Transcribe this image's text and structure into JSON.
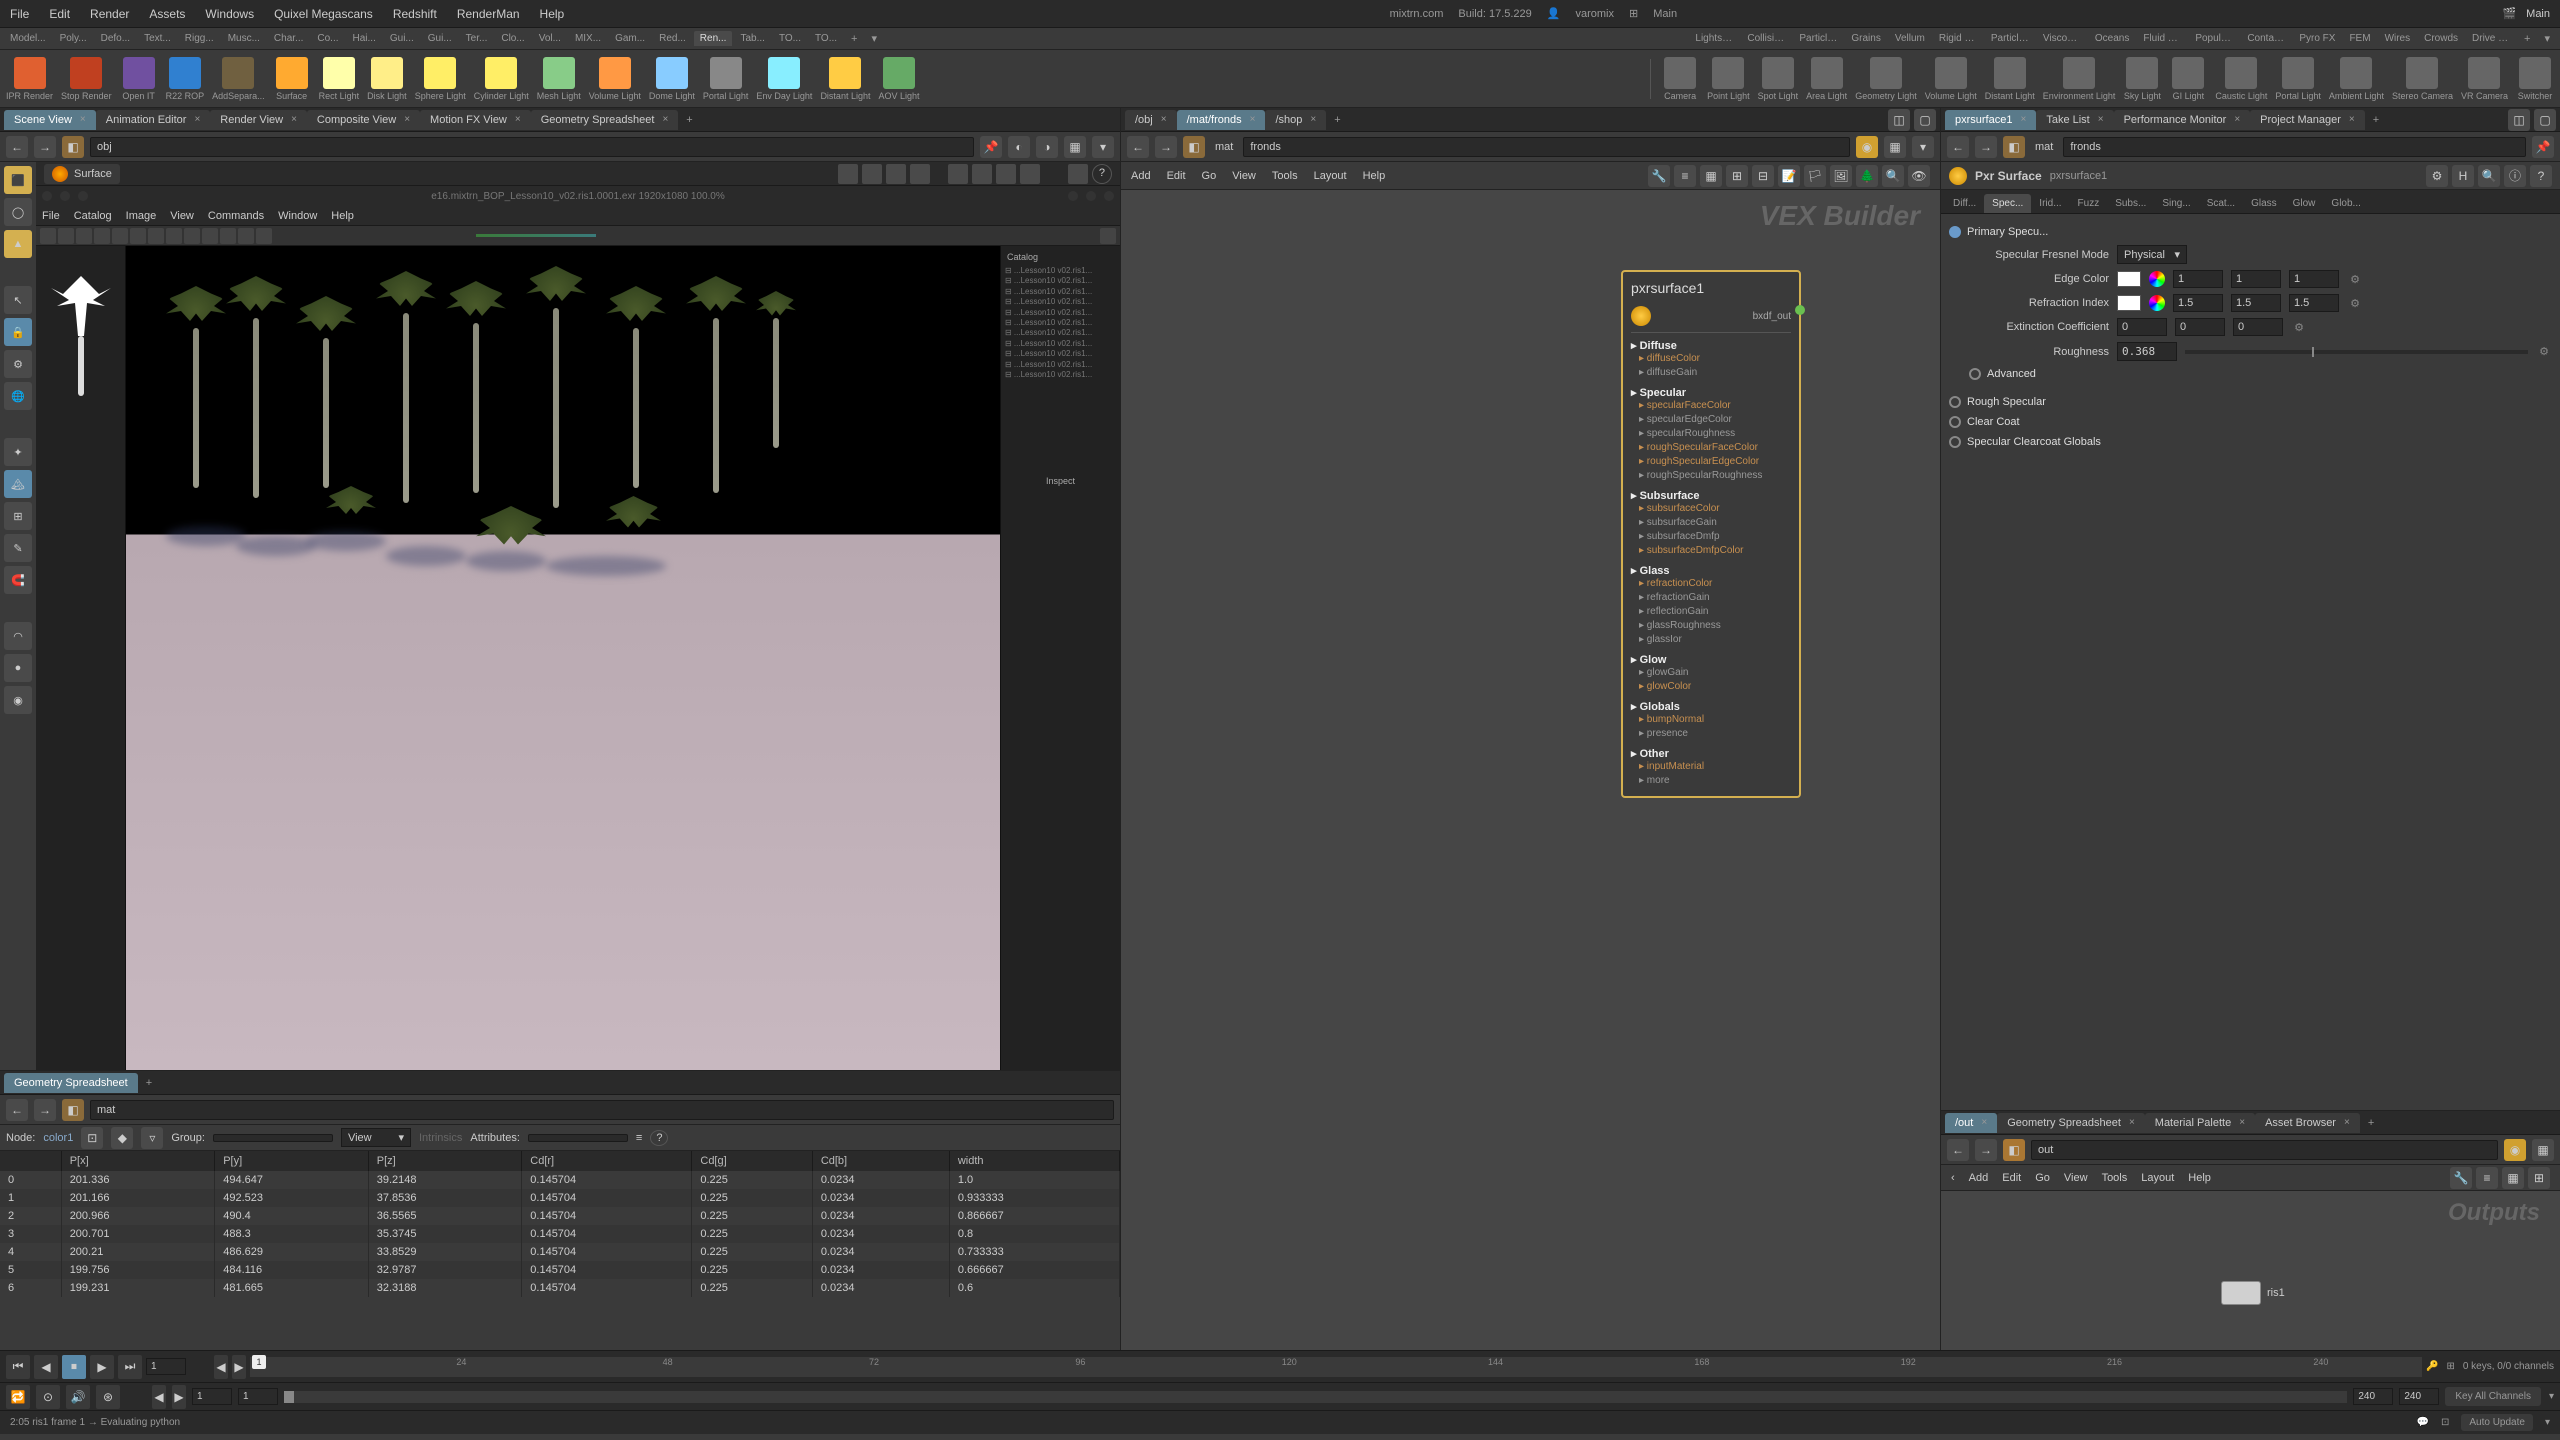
{
  "menubar": {
    "items": [
      "File",
      "Edit",
      "Render",
      "Assets",
      "Windows",
      "Quixel Megascans",
      "Redshift",
      "RenderMan",
      "Help"
    ],
    "center_url": "mixtrn.com",
    "center_build": "Build: 17.5.229",
    "center_user": "varomix",
    "center_desktop": "Main",
    "right_desktop": "Main"
  },
  "shelf_tabs_left": [
    "Model...",
    "Poly...",
    "Defo...",
    "Text...",
    "Rigg...",
    "Musc...",
    "Char...",
    "Co...",
    "Hai...",
    "Gui...",
    "Gui...",
    "Ter...",
    "Clo...",
    "Vol...",
    "MIX...",
    "Gam...",
    "Red...",
    "Ren...",
    "Tab...",
    "TO...",
    "TO..."
  ],
  "shelf_tabs_right": [
    "Lights an...",
    "Collisions",
    "Particles",
    "Grains",
    "Vellum",
    "Rigid Bo...",
    "Particle F...",
    "Viscous F...",
    "Oceans",
    "Fluid Co...",
    "Populate...",
    "Container...",
    "Pyro FX",
    "FEM",
    "Wires",
    "Crowds",
    "Drive Si..."
  ],
  "shelf_tools_left": [
    {
      "label": "IPR Render",
      "color": "#e06030"
    },
    {
      "label": "Stop Render",
      "color": "#c04020"
    },
    {
      "label": "Open IT",
      "color": "#7050a0"
    },
    {
      "label": "R22 ROP",
      "color": "#3080d0"
    },
    {
      "label": "AddSepara...",
      "color": "#706040"
    },
    {
      "label": "Surface",
      "color": "#ffaa30"
    },
    {
      "label": "Rect Light",
      "color": "#ffffaa"
    },
    {
      "label": "Disk Light",
      "color": "#ffee88"
    },
    {
      "label": "Sphere Light",
      "color": "#ffee66"
    },
    {
      "label": "Cylinder Light",
      "color": "#ffee66"
    },
    {
      "label": "Mesh Light",
      "color": "#88cc88"
    },
    {
      "label": "Volume Light",
      "color": "#ff9944"
    },
    {
      "label": "Dome Light",
      "color": "#88ccff"
    },
    {
      "label": "Portal Light",
      "color": "#888888"
    },
    {
      "label": "Env Day Light",
      "color": "#88eeff"
    },
    {
      "label": "Distant Light",
      "color": "#ffcc44"
    },
    {
      "label": "AOV Light",
      "color": "#66aa66"
    }
  ],
  "shelf_tools_right": [
    {
      "label": "Camera"
    },
    {
      "label": "Point Light"
    },
    {
      "label": "Spot Light"
    },
    {
      "label": "Area Light"
    },
    {
      "label": "Geometry Light"
    },
    {
      "label": "Volume Light"
    },
    {
      "label": "Distant Light"
    },
    {
      "label": "Environment Light"
    },
    {
      "label": "Sky Light"
    },
    {
      "label": "GI Light"
    },
    {
      "label": "Caustic Light"
    },
    {
      "label": "Portal Light"
    },
    {
      "label": "Ambient Light"
    },
    {
      "label": "Stereo Camera"
    },
    {
      "label": "VR Camera"
    },
    {
      "label": "Switcher"
    }
  ],
  "left_pane": {
    "tabs": [
      {
        "label": "Scene View",
        "active": true
      },
      {
        "label": "Animation Editor"
      },
      {
        "label": "Render View"
      },
      {
        "label": "Composite View"
      },
      {
        "label": "Motion FX View"
      },
      {
        "label": "Geometry Spreadsheet"
      }
    ],
    "path": "obj",
    "surface_label": "Surface",
    "help_icon": "?",
    "render_preview": {
      "menus": [
        "File",
        "Catalog",
        "Image",
        "View",
        "Commands",
        "Window",
        "Help"
      ],
      "title": "e16.mixtrn_BOP_Lesson10_v02.ris1.0001.exr 1920x1080 100.0%"
    }
  },
  "middle_pane": {
    "tabs": [
      {
        "label": "/obj"
      },
      {
        "label": "/mat/fronds",
        "active": true
      },
      {
        "label": "/shop"
      }
    ],
    "path_root": "mat",
    "path": "fronds",
    "menus": [
      "Add",
      "Edit",
      "Go",
      "View",
      "Tools",
      "Layout",
      "Help"
    ],
    "vex_title": "VEX Builder",
    "node": {
      "name": "pxrsurface1",
      "output": "bxdf_out",
      "sections": [
        {
          "title": "Diffuse",
          "params": [
            {
              "n": "diffuseColor",
              "u": true
            },
            {
              "n": "diffuseGain",
              "u": false
            }
          ]
        },
        {
          "title": "Specular",
          "params": [
            {
              "n": "specularFaceColor",
              "u": true
            },
            {
              "n": "specularEdgeColor",
              "u": false
            },
            {
              "n": "specularRoughness",
              "u": false
            },
            {
              "n": "roughSpecularFaceColor",
              "u": true
            },
            {
              "n": "roughSpecularEdgeColor",
              "u": true
            },
            {
              "n": "roughSpecularRoughness",
              "u": false
            }
          ]
        },
        {
          "title": "Subsurface",
          "params": [
            {
              "n": "subsurfaceColor",
              "u": true
            },
            {
              "n": "subsurfaceGain",
              "u": false
            },
            {
              "n": "subsurfaceDmfp",
              "u": false
            },
            {
              "n": "subsurfaceDmfpColor",
              "u": true
            }
          ]
        },
        {
          "title": "Glass",
          "params": [
            {
              "n": "refractionColor",
              "u": true
            },
            {
              "n": "refractionGain",
              "u": false
            },
            {
              "n": "reflectionGain",
              "u": false
            },
            {
              "n": "glassRoughness",
              "u": false
            },
            {
              "n": "glassIor",
              "u": false
            }
          ]
        },
        {
          "title": "Glow",
          "params": [
            {
              "n": "glowGain",
              "u": false
            },
            {
              "n": "glowColor",
              "u": true
            }
          ]
        },
        {
          "title": "Globals",
          "params": [
            {
              "n": "bumpNormal",
              "u": true
            },
            {
              "n": "presence",
              "u": false
            }
          ]
        },
        {
          "title": "Other",
          "params": [
            {
              "n": "inputMaterial",
              "u": true
            },
            {
              "n": "more",
              "u": false
            }
          ]
        }
      ]
    }
  },
  "right_pane": {
    "tabs": [
      {
        "label": "pxrsurface1",
        "active": true
      },
      {
        "label": "Take List"
      },
      {
        "label": "Performance Monitor"
      },
      {
        "label": "Project Manager"
      }
    ],
    "path_root": "mat",
    "path": "fronds",
    "node_type": "Pxr Surface",
    "node_name": "pxrsurface1",
    "param_tabs": [
      "Diff...",
      "Spec...",
      "Irid...",
      "Fuzz",
      "Subs...",
      "Sing...",
      "Scat...",
      "Glass",
      "Glow",
      "Glob..."
    ],
    "param_tab_active": 1,
    "groups": {
      "primary": "Primary Specu...",
      "rough": "Rough Specular",
      "clearcoat": "Clear Coat",
      "clearcoat_globals": "Specular Clearcoat Globals",
      "advanced": "Advanced"
    },
    "params": {
      "fresnel_mode": {
        "label": "Specular Fresnel Mode",
        "value": "Physical"
      },
      "edge_color": {
        "label": "Edge Color",
        "v1": "1",
        "v2": "1",
        "v3": "1"
      },
      "refraction_index": {
        "label": "Refraction Index",
        "v1": "1.5",
        "v2": "1.5",
        "v3": "1.5"
      },
      "extinction": {
        "label": "Extinction Coefficient",
        "v1": "0",
        "v2": "0",
        "v3": "0"
      },
      "roughness": {
        "label": "Roughness",
        "value": "0.368"
      }
    }
  },
  "spreadsheet": {
    "tab": "Geometry Spreadsheet",
    "node_label": "Node:",
    "node_value": "color1",
    "group_label": "Group:",
    "view_label": "View",
    "intrinsics_label": "Intrinsics",
    "attributes_label": "Attributes:",
    "path": "mat",
    "columns": [
      "",
      "P[x]",
      "P[y]",
      "P[z]",
      "Cd[r]",
      "Cd[g]",
      "Cd[b]",
      "width"
    ],
    "rows": [
      [
        "0",
        "201.336",
        "494.647",
        "39.2148",
        "0.145704",
        "0.225",
        "0.0234",
        "1.0"
      ],
      [
        "1",
        "201.166",
        "492.523",
        "37.8536",
        "0.145704",
        "0.225",
        "0.0234",
        "0.933333"
      ],
      [
        "2",
        "200.966",
        "490.4",
        "36.5565",
        "0.145704",
        "0.225",
        "0.0234",
        "0.866667"
      ],
      [
        "3",
        "200.701",
        "488.3",
        "35.3745",
        "0.145704",
        "0.225",
        "0.0234",
        "0.8"
      ],
      [
        "4",
        "200.21",
        "486.629",
        "33.8529",
        "0.145704",
        "0.225",
        "0.0234",
        "0.733333"
      ],
      [
        "5",
        "199.756",
        "484.116",
        "32.9787",
        "0.145704",
        "0.225",
        "0.0234",
        "0.666667"
      ],
      [
        "6",
        "199.231",
        "481.665",
        "32.3188",
        "0.145704",
        "0.225",
        "0.0234",
        "0.6"
      ]
    ]
  },
  "outputs_pane": {
    "tabs": [
      {
        "label": "/out",
        "active": true
      },
      {
        "label": "Geometry Spreadsheet"
      },
      {
        "label": "Material Palette"
      },
      {
        "label": "Asset Browser"
      }
    ],
    "path": "out",
    "menus": [
      "Add",
      "Edit",
      "Go",
      "View",
      "Tools",
      "Layout",
      "Help"
    ],
    "title": "Outputs",
    "node_name": "ris1"
  },
  "timeline": {
    "current_frame": "1",
    "ticks": [
      "24",
      "48",
      "72",
      "96",
      "120",
      "144",
      "168",
      "192",
      "216",
      "240"
    ],
    "keys_status": "0 keys, 0/0 channels",
    "key_all_channels": "Key All Channels",
    "range_start": "1",
    "range_end": "1",
    "end1": "240",
    "end2": "240"
  },
  "status": {
    "text": "2:05 ris1 frame 1 → Evaluating python",
    "auto_update": "Auto Update"
  }
}
